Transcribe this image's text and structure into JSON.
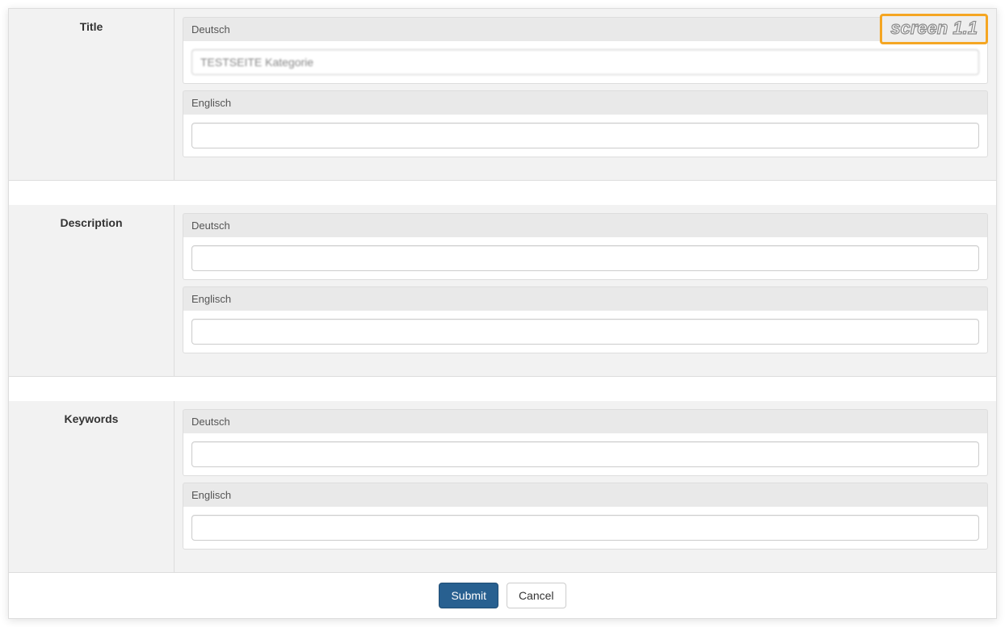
{
  "badge": "screen 1.1",
  "sections": {
    "title": {
      "label": "Title",
      "de_label": "Deutsch",
      "de_value": "TESTSEITE Kategorie",
      "en_label": "Englisch",
      "en_value": ""
    },
    "description": {
      "label": "Description",
      "de_label": "Deutsch",
      "de_value": "",
      "en_label": "Englisch",
      "en_value": ""
    },
    "keywords": {
      "label": "Keywords",
      "de_label": "Deutsch",
      "de_value": "",
      "en_label": "Englisch",
      "en_value": ""
    }
  },
  "actions": {
    "submit": "Submit",
    "cancel": "Cancel"
  }
}
